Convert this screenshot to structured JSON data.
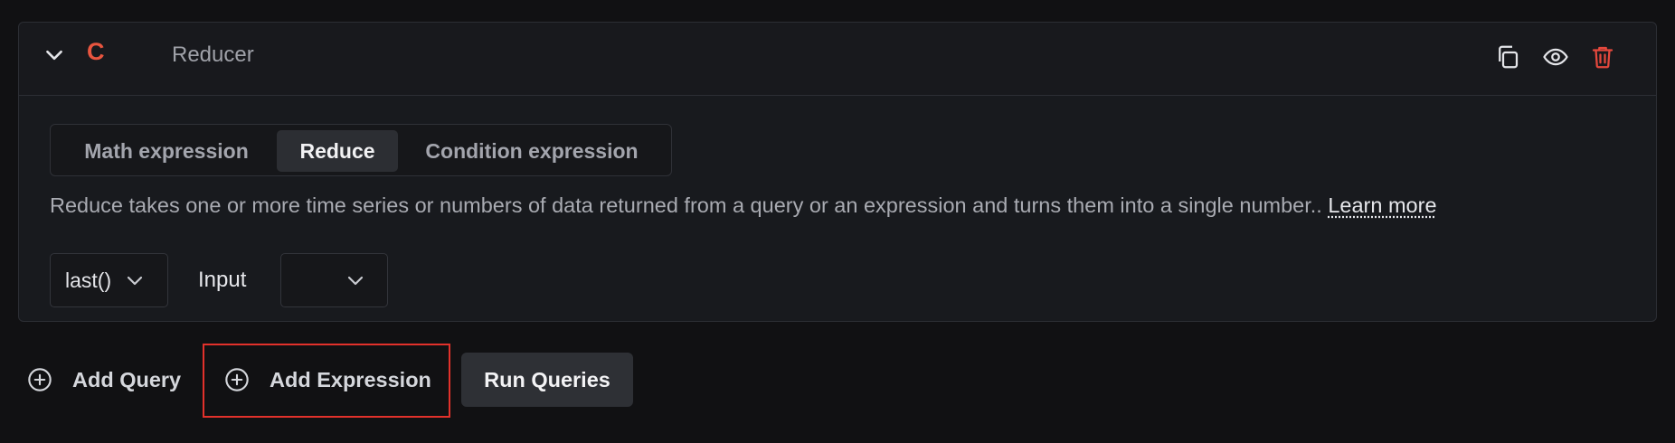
{
  "query": {
    "letter": "C",
    "name": "Reducer",
    "letter_color": "#e8553f",
    "actions": [
      {
        "icon": "copy-icon",
        "label": "Duplicate"
      },
      {
        "icon": "eye-icon",
        "label": "Hide"
      },
      {
        "icon": "trash-icon",
        "label": "Delete",
        "color": "#e5483d"
      }
    ]
  },
  "expression_types": {
    "items": [
      "Math expression",
      "Reduce",
      "Condition expression"
    ],
    "selected": "Reduce"
  },
  "description": {
    "text": "Reduce takes one or more time series or numbers of data returned from a query or an expression and turns them into a single number..",
    "link_label": "Learn more"
  },
  "reducer": {
    "function_value": "last()",
    "input_label": "Input",
    "input_value": ""
  },
  "footer": {
    "add_query_label": "Add Query",
    "add_expression_label": "Add Expression",
    "run_queries_label": "Run Queries",
    "highlight_color": "#e2312b"
  }
}
